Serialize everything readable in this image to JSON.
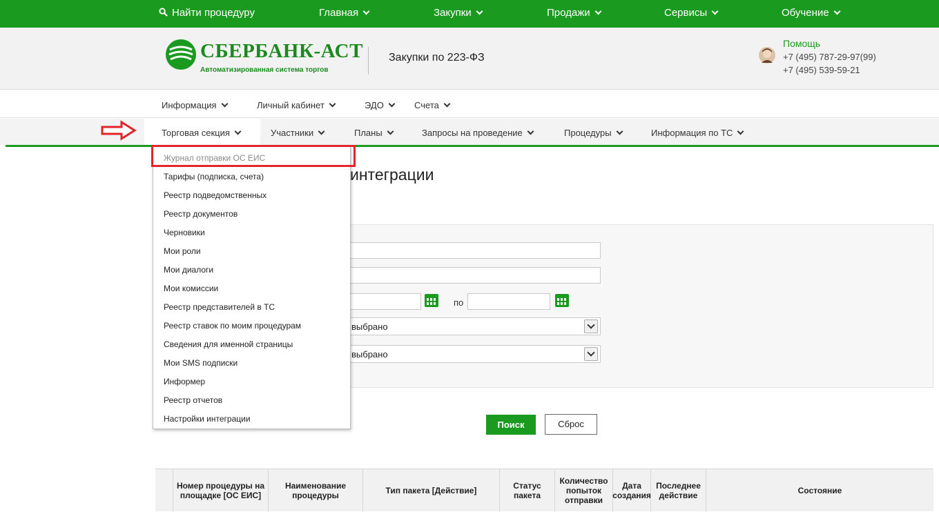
{
  "topbar": {
    "search_label": "Найти процедуру",
    "items": [
      "Главная",
      "Закупки",
      "Продажи",
      "Сервисы",
      "Обучение"
    ]
  },
  "header": {
    "logo_title": "СБЕРБАНК-АСТ",
    "logo_subtitle": "Автоматизированная система торгов",
    "section_title": "Закупки по 223-ФЗ",
    "help_label": "Помощь",
    "phones": [
      "+7 (495) 787-29-97(99)",
      "+7 (495) 539-59-21"
    ]
  },
  "menu_primary": [
    "Информация",
    "Личный кабинет",
    "ЭДО",
    "Счета"
  ],
  "menu_secondary": [
    "Торговая секция",
    "Участники",
    "Планы",
    "Запросы на проведение",
    "Процедуры",
    "Информация по ТС"
  ],
  "dropdown": {
    "items": [
      "Журнал отправки ОС ЕИС",
      "Тарифы (подписка, счета)",
      "Реестр подведомственных",
      "Реестр документов",
      "Черновики",
      "Мои роли",
      "Мои диалоги",
      "Мои комиссии",
      "Реестр представителей в ТС",
      "Реестр ставок по моим процедурам",
      "Сведения для именной страницы",
      "Мои SMS подписки",
      "Информер",
      "Реестр отчетов",
      "Настройки интеграции"
    ]
  },
  "page": {
    "title_fragment": "интеграции"
  },
  "filter": {
    "date_to_label": "по",
    "select1_value": "выбрано",
    "select2_value": "выбрано"
  },
  "buttons": {
    "search": "Поиск",
    "reset": "Сброс"
  },
  "table": {
    "headers": [
      "Номер процедуры на площадке [ОС ЕИС]",
      "Наименование процедуры",
      "Тип пакета [Действие]",
      "Статус пакета",
      "Количество попыток отправки",
      "Дата создания",
      "Последнее действие",
      "Состояние"
    ]
  },
  "colors": {
    "brand_green": "#1a9a1f",
    "highlight_red": "#e0262b"
  }
}
